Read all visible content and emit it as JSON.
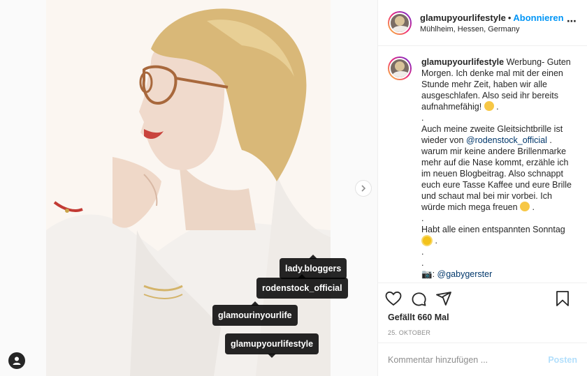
{
  "header": {
    "username": "glamupyourlifestyle",
    "separator": "•",
    "follow_label": "Abonnieren",
    "location": "Mühlheim, Hessen, Germany",
    "more_label": "⋯"
  },
  "caption": {
    "username": "glamupyourlifestyle",
    "p1": "Werbung- Guten Morgen. Ich denke mal mit der einen Stunde mehr Zeit, haben wir alle ausgeschlafen. Also seid ihr bereits aufnahmefähig!",
    "p1_end": ".",
    "dot1": ".",
    "p2_start": "Auch meine zweite Gleitsichtbrille ist wieder von",
    "mention1": "@rodenstock_official",
    "p2_end": ". warum mir keine andere Brillenmarke mehr auf die Nase kommt, erzähle ich im neuen Blogbeitrag. Also schnappt euch eure Tasse Kaffee und eure Brille und schaut mal bei mir vorbei. Ich würde mich mega freuen",
    "p2_tail": ".",
    "dot2": ".",
    "p3": "Habt alle einen entspannten Sonntag",
    "p3_end": ".",
    "dot3": ".",
    "dot4": ".",
    "camera": "📷:",
    "mention2": "@gabygerster"
  },
  "tags": [
    {
      "label": "lady.bloggers"
    },
    {
      "label": "rodenstock_official"
    },
    {
      "label": "glamourinyourlife"
    },
    {
      "label": "glamupyourlifestyle"
    }
  ],
  "footer": {
    "likes": "Gefällt 660 Mal",
    "date": "25. OKTOBER",
    "comment_placeholder": "Kommentar hinzufügen ...",
    "post_label": "Posten"
  },
  "icons": [
    "heart-icon",
    "comment-icon",
    "share-icon",
    "bookmark-icon",
    "next-arrow-icon",
    "user-tag-icon",
    "more-icon"
  ],
  "colors": {
    "accent": "#0095f6",
    "post_disabled": "#b2dffc",
    "muted": "#8e8e8e"
  }
}
